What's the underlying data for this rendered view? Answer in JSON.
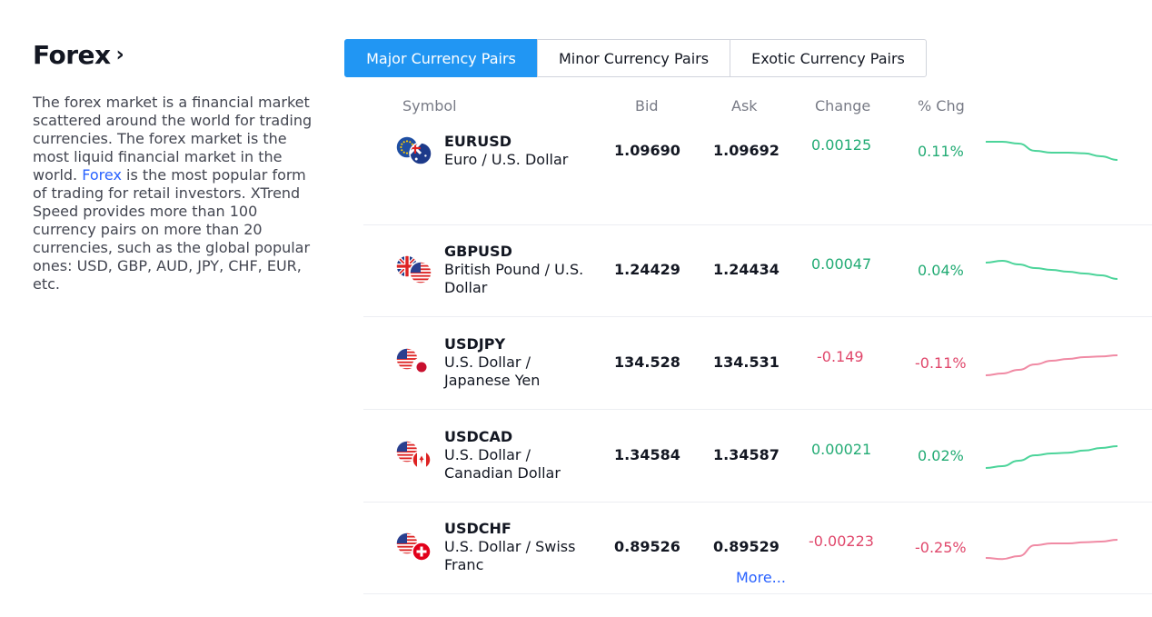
{
  "page": {
    "title": "Forex",
    "description_before": "The forex market is a financial market scattered around the world for trading currencies. The forex market is the most liquid financial market in the world. ",
    "description_link": "Forex",
    "description_after": " is the most popular form of trading for retail investors. XTrend Speed provides more than 100 currency pairs on more than 20 currencies, such as the global popular ones: USD, GBP, AUD, JPY, CHF, EUR, etc."
  },
  "tabs": [
    {
      "label": "Major Currency Pairs",
      "active": true
    },
    {
      "label": "Minor Currency Pairs",
      "active": false
    },
    {
      "label": "Exotic Currency Pairs",
      "active": false
    }
  ],
  "table": {
    "headers": {
      "symbol": "Symbol",
      "bid": "Bid",
      "ask": "Ask",
      "change": "Change",
      "pct": "% Chg"
    },
    "rows": [
      {
        "code": "EURUSD",
        "name": "Euro / U.S. Dollar",
        "bid": "1.09690",
        "ask": "1.09692",
        "change": "0.00125",
        "pct": "0.11%",
        "direction": "up",
        "flags": [
          "eu-flag-icon",
          "au-flag-icon"
        ],
        "trend": [
          0.8,
          0.8,
          0.75,
          0.55,
          0.5,
          0.5,
          0.48,
          0.4,
          0.3
        ]
      },
      {
        "code": "GBPUSD",
        "name": "British Pound / U.S. Dollar",
        "bid": "1.24429",
        "ask": "1.24434",
        "change": "0.00047",
        "pct": "0.04%",
        "direction": "up",
        "flags": [
          "uk-flag-icon",
          "us-flag-icon"
        ],
        "trend": [
          0.75,
          0.8,
          0.7,
          0.6,
          0.55,
          0.5,
          0.45,
          0.4,
          0.3
        ]
      },
      {
        "code": "USDJPY",
        "name": "U.S. Dollar / Japanese Yen",
        "bid": "134.528",
        "ask": "134.531",
        "change": "-0.149",
        "pct": "-0.11%",
        "direction": "down",
        "flags": [
          "us-flag-icon",
          "jp-flag-icon"
        ],
        "trend": [
          0.2,
          0.25,
          0.35,
          0.5,
          0.6,
          0.65,
          0.7,
          0.72,
          0.75
        ]
      },
      {
        "code": "USDCAD",
        "name": "U.S. Dollar / Canadian Dollar",
        "bid": "1.34584",
        "ask": "1.34587",
        "change": "0.00021",
        "pct": "0.02%",
        "direction": "up",
        "flags": [
          "us-flag-icon",
          "ca-flag-icon"
        ],
        "trend": [
          0.2,
          0.25,
          0.4,
          0.55,
          0.6,
          0.62,
          0.68,
          0.75,
          0.8
        ]
      },
      {
        "code": "USDCHF",
        "name": "U.S. Dollar / Swiss Franc",
        "bid": "0.89526",
        "ask": "0.89529",
        "change": "-0.00223",
        "pct": "-0.25%",
        "direction": "down",
        "flags": [
          "us-flag-icon",
          "ch-flag-icon"
        ],
        "trend": [
          0.25,
          0.22,
          0.3,
          0.6,
          0.65,
          0.65,
          0.68,
          0.7,
          0.75
        ]
      }
    ]
  },
  "more_link": "More...",
  "colors": {
    "accent": "#2196f3",
    "link": "#2962ff",
    "up": "#22ab74",
    "down": "#e0476b",
    "up_line": "#4cd49a",
    "down_line": "#f08aa4"
  }
}
